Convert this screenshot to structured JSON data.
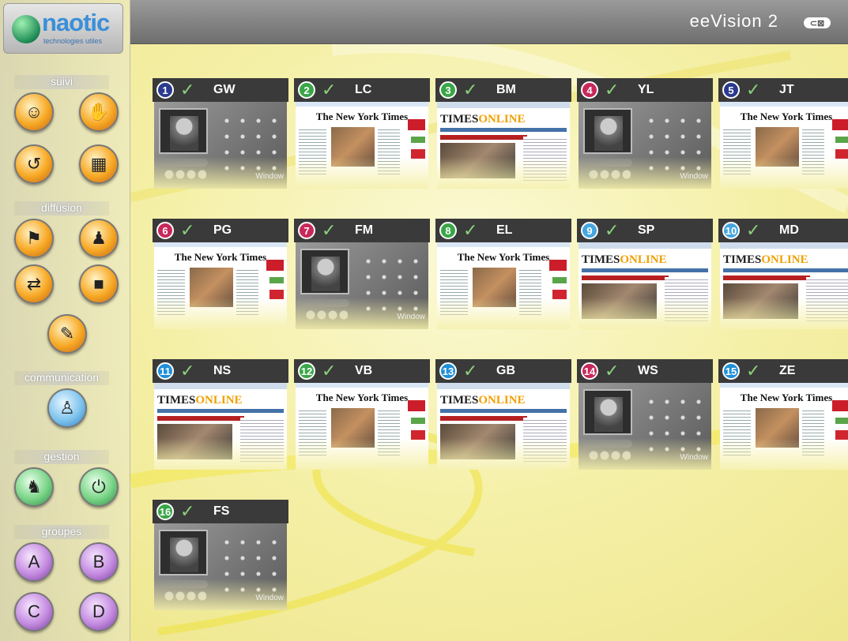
{
  "app": {
    "title": "eeVision 2",
    "exit_label": "⊂⊠",
    "logo_text": "naotic",
    "logo_subtitle": "technologies utiles"
  },
  "sidebar": {
    "sections": [
      {
        "label": "suivi",
        "buttons": [
          {
            "icon": "face-icon",
            "glyph": "☺",
            "color": "orange"
          },
          {
            "icon": "hand-icon",
            "glyph": "✋",
            "color": "orange"
          },
          {
            "icon": "history-icon",
            "glyph": "↺",
            "color": "orange"
          },
          {
            "icon": "grid-icon",
            "glyph": "▦",
            "color": "orange"
          }
        ]
      },
      {
        "label": "diffusion",
        "buttons": [
          {
            "icon": "presenter-icon",
            "glyph": "⚑",
            "color": "orange"
          },
          {
            "icon": "teacher-icon",
            "glyph": "♟",
            "color": "orange"
          },
          {
            "icon": "window-share-icon",
            "glyph": "⇄",
            "color": "orange"
          },
          {
            "icon": "screen-icon",
            "glyph": "■",
            "color": "orange"
          },
          {
            "icon": "document-icon",
            "glyph": "✎",
            "color": "orange"
          }
        ]
      },
      {
        "label": "communication",
        "buttons": [
          {
            "icon": "people-talk-icon",
            "glyph": "♙",
            "color": "blue"
          }
        ]
      },
      {
        "label": "gestion",
        "buttons": [
          {
            "icon": "group-icon",
            "glyph": "♞",
            "color": "green"
          },
          {
            "icon": "power-user-icon",
            "glyph": "⏻",
            "color": "green"
          }
        ]
      },
      {
        "label": "groupes",
        "buttons": [
          {
            "icon": "group-a-icon",
            "glyph": "A",
            "color": "purple"
          },
          {
            "icon": "group-b-icon",
            "glyph": "B",
            "color": "purple"
          },
          {
            "icon": "group-c-icon",
            "glyph": "C",
            "color": "purple"
          },
          {
            "icon": "group-d-icon",
            "glyph": "D",
            "color": "purple"
          }
        ]
      }
    ]
  },
  "stations": [
    {
      "num": "1",
      "code": "GW",
      "color": "#2b3a8e",
      "screen": "player"
    },
    {
      "num": "2",
      "code": "LC",
      "color": "#3aa648",
      "screen": "nyt"
    },
    {
      "num": "3",
      "code": "BM",
      "color": "#3aa648",
      "screen": "times"
    },
    {
      "num": "4",
      "code": "YL",
      "color": "#c8285a",
      "screen": "player"
    },
    {
      "num": "5",
      "code": "JT",
      "color": "#2b3a8e",
      "screen": "nyt"
    },
    {
      "num": "6",
      "code": "PG",
      "color": "#c8285a",
      "screen": "nyt"
    },
    {
      "num": "7",
      "code": "FM",
      "color": "#c8285a",
      "screen": "player"
    },
    {
      "num": "8",
      "code": "EL",
      "color": "#3aa648",
      "screen": "nyt"
    },
    {
      "num": "9",
      "code": "SP",
      "color": "#45a6e0",
      "screen": "times"
    },
    {
      "num": "10",
      "code": "MD",
      "color": "#45a6e0",
      "screen": "times"
    },
    {
      "num": "11",
      "code": "NS",
      "color": "#2090d8",
      "screen": "times"
    },
    {
      "num": "12",
      "code": "VB",
      "color": "#3aa648",
      "screen": "nyt"
    },
    {
      "num": "13",
      "code": "GB",
      "color": "#2090d8",
      "screen": "times"
    },
    {
      "num": "14",
      "code": "WS",
      "color": "#c8285a",
      "screen": "player"
    },
    {
      "num": "15",
      "code": "ZE",
      "color": "#2090d8",
      "screen": "nyt"
    },
    {
      "num": "16",
      "code": "FS",
      "color": "#3aa648",
      "screen": "player"
    }
  ],
  "thumb_text": {
    "nyt_masthead": "The New York Times",
    "times_name": "TIMES",
    "times_suffix": "ONLINE",
    "player_brand": "Window"
  }
}
